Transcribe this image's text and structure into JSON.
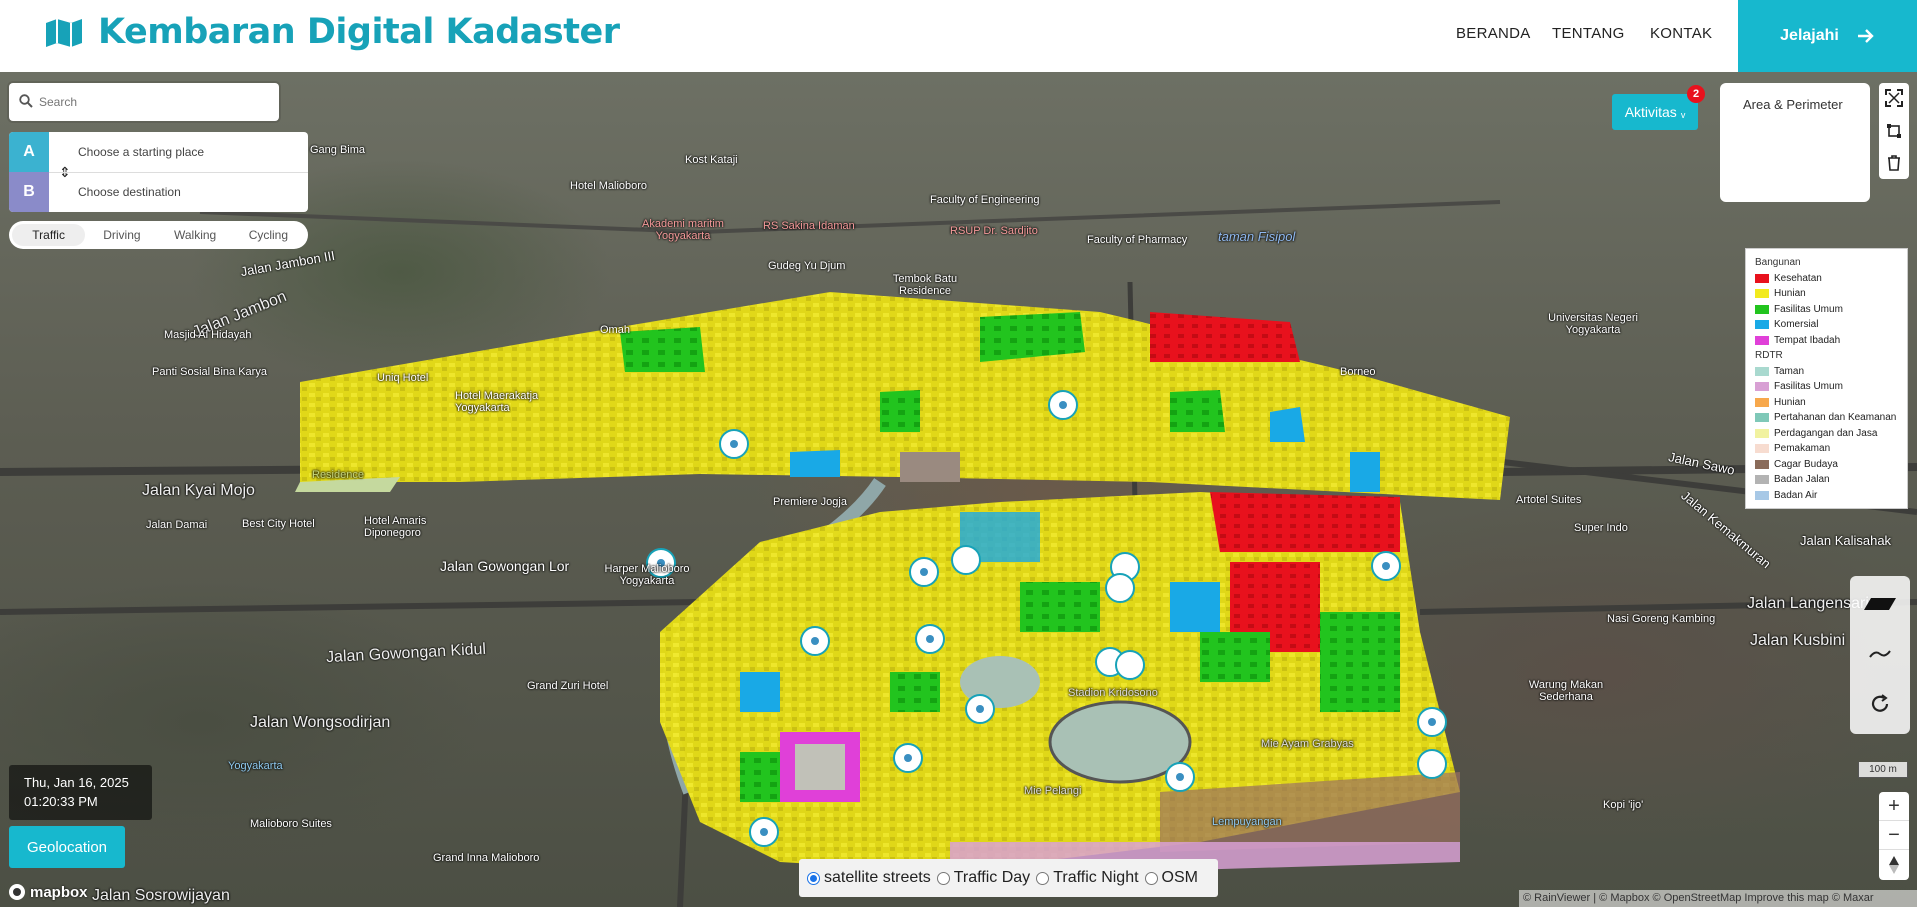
{
  "header": {
    "title": "Kembaran Digital Kadaster",
    "nav": [
      "BERANDA",
      "TENTANG",
      "KONTAK"
    ],
    "cta_label": "Jelajahi",
    "brand_color": "#17a2b8"
  },
  "search": {
    "placeholder": "Search"
  },
  "directions": {
    "marker_a": "A",
    "marker_b": "B",
    "start_placeholder": "Choose a starting place",
    "dest_placeholder": "Choose destination"
  },
  "profiles": {
    "items": [
      "Traffic",
      "Driving",
      "Walking",
      "Cycling"
    ],
    "active": "Traffic"
  },
  "datetime": {
    "date": "Thu, Jan 16, 2025",
    "time": "01:20:33 PM"
  },
  "geolocation_label": "Geolocation",
  "mapbox_label": "mapbox",
  "style_switcher": {
    "options": [
      "satellite streets",
      "Traffic Day",
      "Traffic Night",
      "OSM"
    ],
    "selected": "satellite streets"
  },
  "attribution": "© RainViewer | © Mapbox © OpenStreetMap Improve this map © Maxar",
  "aktivitas": {
    "label": "Aktivitas",
    "badge": "2"
  },
  "area_panel": {
    "title": "Area & Perimeter"
  },
  "legend": {
    "sections": [
      {
        "title": "Bangunan",
        "items": [
          {
            "label": "Kesehatan",
            "color": "#e8111d"
          },
          {
            "label": "Hunian",
            "color": "#f2ea1e"
          },
          {
            "label": "Fasilitas Umum",
            "color": "#22c41e"
          },
          {
            "label": "Komersial",
            "color": "#19a9e6"
          },
          {
            "label": "Tempat Ibadah",
            "color": "#e040d8"
          }
        ]
      },
      {
        "title": "RDTR",
        "items": [
          {
            "label": "Taman",
            "color": "#a9d9cf"
          },
          {
            "label": "Fasilitas Umum",
            "color": "#d8a0d4"
          },
          {
            "label": "Hunian",
            "color": "#f7a84c"
          },
          {
            "label": "Pertahanan dan Keamanan",
            "color": "#7fc8b8"
          },
          {
            "label": "Perdagangan dan Jasa",
            "color": "#f1f2a0"
          },
          {
            "label": "Pemakaman",
            "color": "#f7dcd0"
          },
          {
            "label": "Cagar Budaya",
            "color": "#8a6b5a"
          },
          {
            "label": "Badan Jalan",
            "color": "#b3b3b3"
          },
          {
            "label": "Badan Air",
            "color": "#a7c8e6"
          }
        ]
      }
    ]
  },
  "scale_label": "100 m",
  "map_labels": {
    "jalan_kyai_mojo": "Jalan Kyai Mojo",
    "jalan_jambon": "Jalan Jambon",
    "jalan_gowongan_kidul": "Jalan Gowongan Kidul",
    "jalan_gowongan_lor": "Jalan Gowongan Lor",
    "jalan_wongsodirjan": "Jalan Wongsodirjan",
    "jalan_sosrowijayan": "Jalan Sosrowijayan",
    "jalan_langensari": "Jalan Langensari",
    "jalan_kusbini": "Jalan Kusbini",
    "jalan_kalisahak": "Jalan Kalisahak",
    "jalan_kemakmuran": "Jalan Kemakmuran",
    "premiere_jogja": "Premiere Jogja",
    "artotel_suites": "Artotel Suites",
    "super_indo": "Super Indo",
    "best_city_hotel": "Best City Hotel",
    "harper_malioboro": "Harper Malioboro Yogyakarta",
    "grand_zuri": "Grand Zuri Hotel",
    "malioboro_suites": "Malioboro Suites",
    "grand_inna": "Grand Inna Malioboro",
    "yogyakarta": "Yogyakarta",
    "lempuyangan": "Lempuyangan",
    "mie_ayam": "Mie Ayam Grabyas",
    "mie_pelangi": "Mie Pelangi",
    "stadion_kridosono": "Stadion Kridosono",
    "kopi_ijo": "Kopi 'ijo'",
    "nasi_goreng": "Nasi Goreng Kambing",
    "warung_makan": "Warung Makan Sederhana",
    "faculty_pharmacy": "Faculty of Pharmacy",
    "faculty_engineering": "Faculty of Engineering",
    "rs_sardjito": "RSUP Dr. Sardjito",
    "panti_sosial": "Panti Sosial Bina Karya",
    "masjid_hidayah": "Masjid Al Hidayah",
    "uniq_hotel": "Uniq Hotel",
    "hotel_maerakatja": "Hotel Maerakatja Yogyakarta",
    "jalan_damai": "Jalan Damai",
    "hotel_amaris": "Hotel Amaris Diponegoro",
    "taman_fisipol": "taman Fisipol",
    "universitas_negeri": "Universitas Negeri Yogyakarta",
    "gudeg_yu_djum": "Gudeg Yu Djum",
    "tembok_batu": "Tembok Batu Residence",
    "jalan_sawo": "Jalan Sawo",
    "omah": "Omah",
    "borneo": "Borneo",
    "residence": "Residence",
    "jalan_gejayan": "Jalan Jambon III",
    "gang_bima": "Gang Bima",
    "kost_kataji": "Kost Kataji",
    "akademi_maritim": "Akademi maritim Yogyakarta",
    "rs_sakina": "RS Sakina Idaman",
    "hotel_malioboro": "Hotel Malioboro"
  }
}
